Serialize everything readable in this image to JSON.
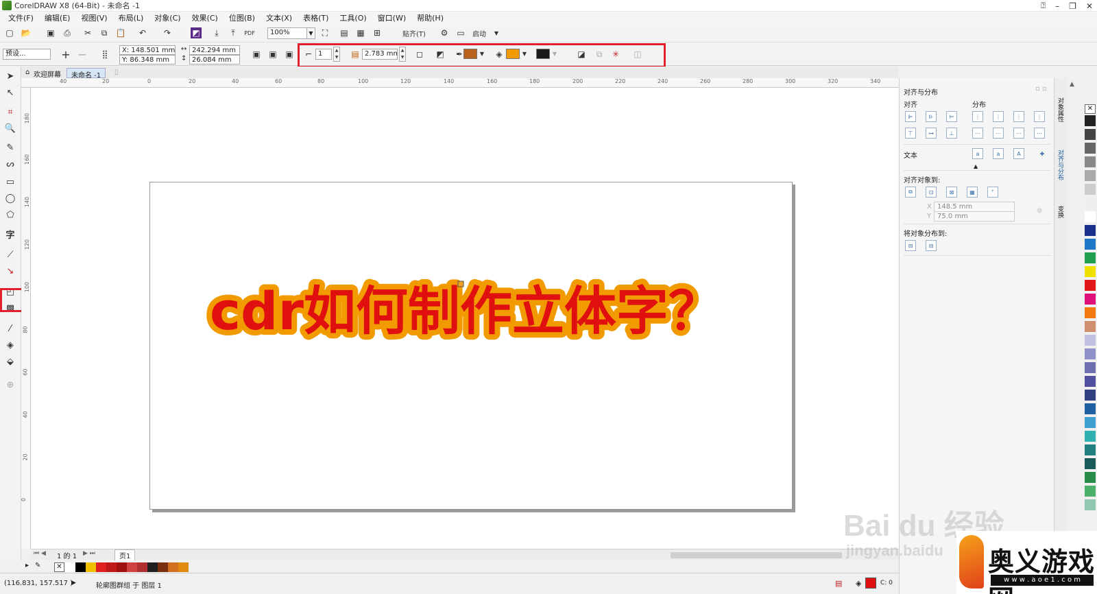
{
  "window": {
    "title": "CorelDRAW X8 (64-Bit) - 未命名 -1"
  },
  "menu": [
    "文件(F)",
    "编辑(E)",
    "视图(V)",
    "布局(L)",
    "对象(C)",
    "效果(C)",
    "位图(B)",
    "文本(X)",
    "表格(T)",
    "工具(O)",
    "窗口(W)",
    "帮助(H)"
  ],
  "standard_toolbar": {
    "zoom": "100%",
    "snap_label": "贴齐(T)",
    "launch_label": "启动"
  },
  "property_bar": {
    "preset": "预设...",
    "x": "X: 148.501 mm",
    "y": "Y: 86.348 mm",
    "width": "242.294 mm",
    "height": "26.084 mm",
    "steps": "1",
    "offset": "2.783 mm",
    "outline_color": "#b8621b",
    "fill_color": "#f09a00",
    "contour_color": "#1a1a1a"
  },
  "document_tabs": {
    "welcome": "欢迎屏幕",
    "current": "未命名 -1"
  },
  "ruler": {
    "h_labels": [
      "40",
      "20",
      "0",
      "20",
      "40",
      "60",
      "80",
      "100",
      "120",
      "140",
      "160",
      "180",
      "200",
      "220",
      "240",
      "260",
      "280",
      "300",
      "320",
      "340"
    ],
    "v_labels": [
      "180",
      "160",
      "140",
      "120",
      "100",
      "80",
      "60",
      "40",
      "20",
      "0"
    ]
  },
  "canvas": {
    "headline": "cdr如何制作立体字？",
    "text_color": "#e01010",
    "contour_color": "#f29b00"
  },
  "page_nav": {
    "position": "1 的 1",
    "page_tab": "页1"
  },
  "status": {
    "coords": "(116.831, 157.517 )",
    "message": "轮廓图群组 于 图层 1",
    "fill_label": "C: 0"
  },
  "docker": {
    "title": "对齐与分布",
    "align_label": "对齐",
    "distribute_label": "分布",
    "text_label": "文本",
    "align_to_label": "对齐对象到:",
    "x_value": "148.5 mm",
    "y_value": "75.0 mm",
    "distribute_to_label": "将对象分布到:"
  },
  "vertical_tabs": [
    "对象属性",
    "对齐与分布",
    "变换"
  ],
  "bottom_palette": [
    "#ffffff",
    "#000000",
    "#f0c000",
    "#e02020",
    "#c01818",
    "#a01010",
    "#d04040",
    "#b03030",
    "#202020",
    "#7a3010",
    "#d07020",
    "#e08a10"
  ],
  "right_palette": [
    "#222222",
    "#444444",
    "#666666",
    "#888888",
    "#aaaaaa",
    "#cccccc",
    "#eeeeee",
    "#ffffff",
    "#1a2e8c",
    "#1f77c8",
    "#20a050",
    "#f0e000",
    "#e01818",
    "#e0107a",
    "#f07a10",
    "#d09070",
    "#c0c0e0",
    "#9090c8",
    "#6f6fb0",
    "#5050a0",
    "#304080",
    "#2060a0",
    "#40a0d0",
    "#30b0b0",
    "#208080",
    "#1a5a5a",
    "#2a8a4a",
    "#4ab06a",
    "#90c8b0"
  ],
  "watermark": {
    "text": "Bai du 经验",
    "sub": "jingyan.baidu",
    "brand": "奥义游戏网",
    "brand_url": "w w w . a o e 1 . c o m"
  }
}
